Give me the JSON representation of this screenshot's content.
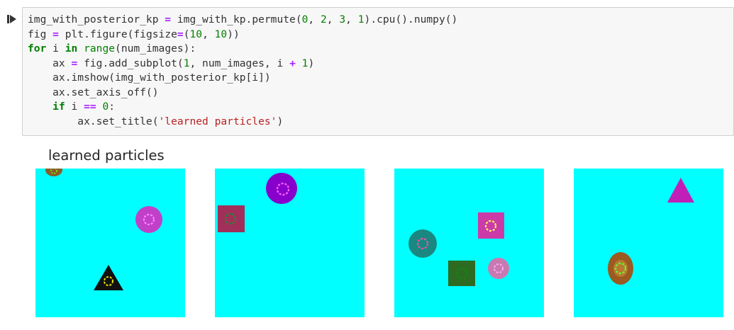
{
  "cell": {
    "code_lines": [
      [
        {
          "t": "img_with_posterior_kp ",
          "c": ""
        },
        {
          "t": "=",
          "c": "op"
        },
        {
          "t": " img_with_kp.permute(",
          "c": ""
        },
        {
          "t": "0",
          "c": "num"
        },
        {
          "t": ", ",
          "c": ""
        },
        {
          "t": "2",
          "c": "num"
        },
        {
          "t": ", ",
          "c": ""
        },
        {
          "t": "3",
          "c": "num"
        },
        {
          "t": ", ",
          "c": ""
        },
        {
          "t": "1",
          "c": "num"
        },
        {
          "t": ").cpu().numpy()",
          "c": ""
        }
      ],
      [
        {
          "t": "fig ",
          "c": ""
        },
        {
          "t": "=",
          "c": "op"
        },
        {
          "t": " plt.figure(figsize",
          "c": ""
        },
        {
          "t": "=",
          "c": "op"
        },
        {
          "t": "(",
          "c": ""
        },
        {
          "t": "10",
          "c": "num"
        },
        {
          "t": ", ",
          "c": ""
        },
        {
          "t": "10",
          "c": "num"
        },
        {
          "t": "))",
          "c": ""
        }
      ],
      [
        {
          "t": "for",
          "c": "kw"
        },
        {
          "t": " i ",
          "c": ""
        },
        {
          "t": "in",
          "c": "kw"
        },
        {
          "t": " ",
          "c": ""
        },
        {
          "t": "range",
          "c": "bi"
        },
        {
          "t": "(num_images):",
          "c": ""
        }
      ],
      [
        {
          "t": "    ax ",
          "c": ""
        },
        {
          "t": "=",
          "c": "op"
        },
        {
          "t": " fig.add_subplot(",
          "c": ""
        },
        {
          "t": "1",
          "c": "num"
        },
        {
          "t": ", num_images, i ",
          "c": ""
        },
        {
          "t": "+",
          "c": "op"
        },
        {
          "t": " ",
          "c": ""
        },
        {
          "t": "1",
          "c": "num"
        },
        {
          "t": ")",
          "c": ""
        }
      ],
      [
        {
          "t": "    ax.imshow(img_with_posterior_kp[i])",
          "c": ""
        }
      ],
      [
        {
          "t": "    ax.set_axis_off()",
          "c": ""
        }
      ],
      [
        {
          "t": "    ",
          "c": ""
        },
        {
          "t": "if",
          "c": "kw"
        },
        {
          "t": " i ",
          "c": ""
        },
        {
          "t": "==",
          "c": "op"
        },
        {
          "t": " ",
          "c": ""
        },
        {
          "t": "0",
          "c": "num"
        },
        {
          "t": ":",
          "c": ""
        }
      ],
      [
        {
          "t": "        ax.set_title(",
          "c": ""
        },
        {
          "t": "'learned particles'",
          "c": "str"
        },
        {
          "t": ")",
          "c": ""
        }
      ]
    ]
  },
  "output": {
    "title": "learned particles"
  },
  "colors": {
    "background": "#00ffff",
    "keyword": "#008000",
    "operator": "#aa22ff",
    "string": "#ba2121"
  },
  "panels": [
    {
      "shapes": [
        "magenta-circle",
        "black-triangle",
        "partial-shape-top-left"
      ]
    },
    {
      "shapes": [
        "purple-circle",
        "maroon-square"
      ]
    },
    {
      "shapes": [
        "magenta-square",
        "teal-circle",
        "dark-green-square",
        "pink-circle"
      ]
    },
    {
      "shapes": [
        "magenta-triangle",
        "brown-circle"
      ]
    }
  ]
}
